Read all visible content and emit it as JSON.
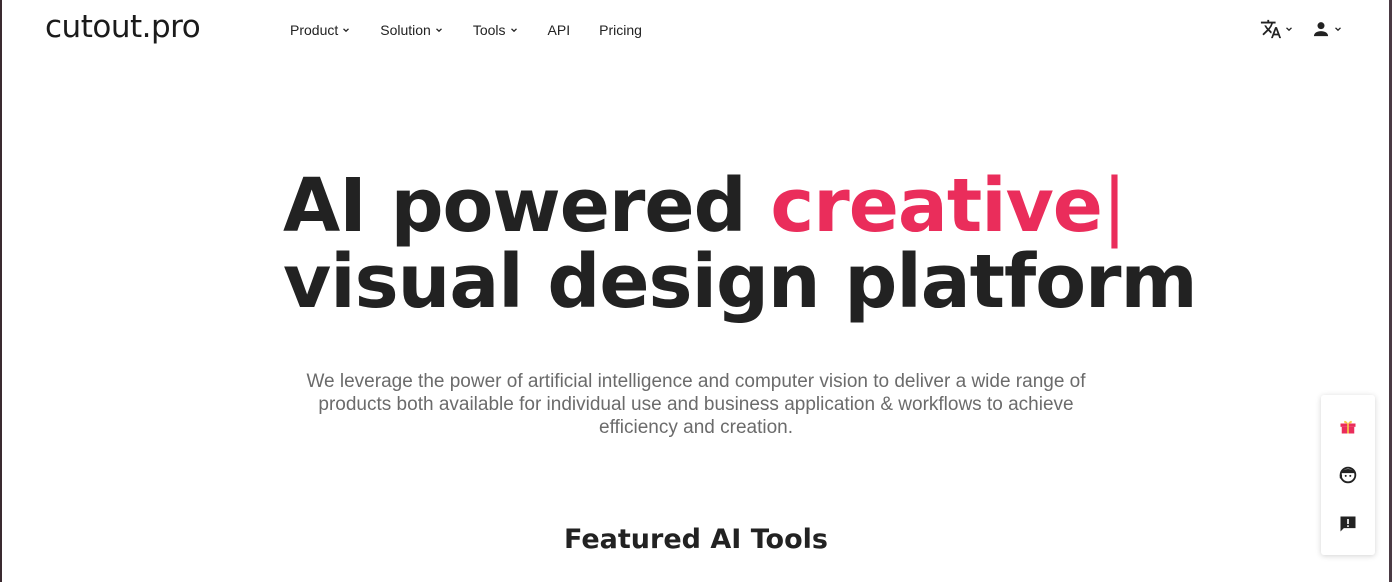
{
  "brand": {
    "logo_text": "cutout.pro"
  },
  "nav": {
    "items": [
      {
        "label": "Product",
        "has_dropdown": true
      },
      {
        "label": "Solution",
        "has_dropdown": true
      },
      {
        "label": "Tools",
        "has_dropdown": true
      },
      {
        "label": "API",
        "has_dropdown": false
      },
      {
        "label": "Pricing",
        "has_dropdown": false
      }
    ]
  },
  "header_icons": {
    "language": "translate-icon",
    "account": "user-icon"
  },
  "hero": {
    "title_prefix": "AI powered ",
    "title_accent": "creative",
    "caret": "|",
    "title_line2": "visual design platform",
    "subtitle": "We leverage the power of artificial intelligence and computer vision to deliver a wide range of products both available for individual use and business application & workflows to achieve efficiency and creation."
  },
  "section": {
    "featured_title": "Featured AI Tools"
  },
  "side_widget": {
    "items": [
      "gift-icon",
      "support-agent-icon",
      "feedback-icon"
    ]
  },
  "colors": {
    "accent": "#ea2d5b",
    "text": "#222222",
    "muted": "#6b6b6b",
    "gift": "#ea2d5b"
  }
}
